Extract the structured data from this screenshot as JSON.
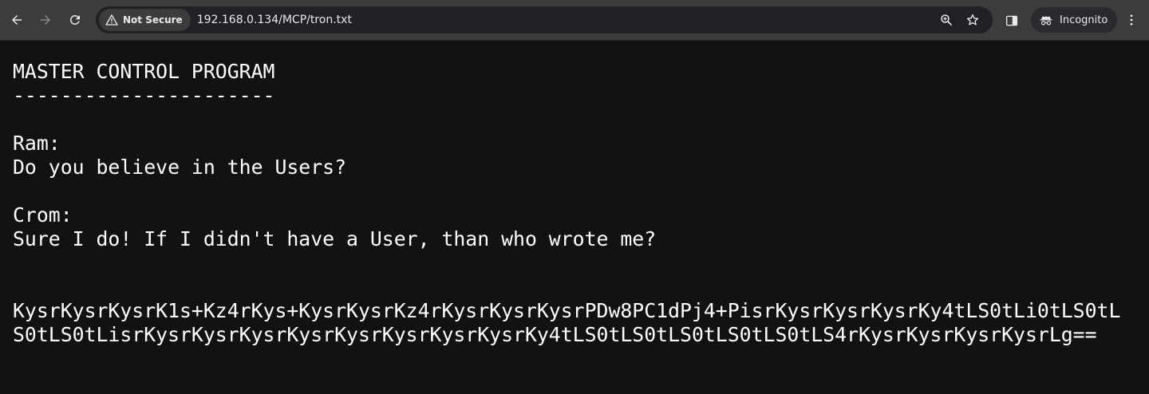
{
  "browser": {
    "security_label": "Not Secure",
    "url": "192.168.0.134/MCP/tron.txt",
    "profile_label": "Incognito",
    "icons": [
      "back-icon",
      "forward-icon",
      "reload-icon",
      "warning-icon",
      "zoom-icon",
      "star-icon",
      "side-panel-icon",
      "incognito-icon",
      "kebab-menu-icon"
    ]
  },
  "document": {
    "title": "MASTER CONTROL PROGRAM",
    "underline": "----------------------",
    "speaker1": "Ram:",
    "line1": "Do you believe in the Users?",
    "speaker2": "Crom:",
    "line2": "Sure I do! If I didn't have a User, than who wrote me?",
    "encoded": "KysrKysrKysrK1s+Kz4rKys+KysrKysrKz4rKysrKysrKysrPDw8PC1dPj4+PisrKysrKysrKysrKy4tLS0tLi0tLS0tLS0tLS0tLisrKysrKysrKysrKysrKysrKysrKysrKysrKy4tLS0tLS0tLS0tLS0tLS0tLS4rKysrKysrKysrKysrLg=="
  }
}
